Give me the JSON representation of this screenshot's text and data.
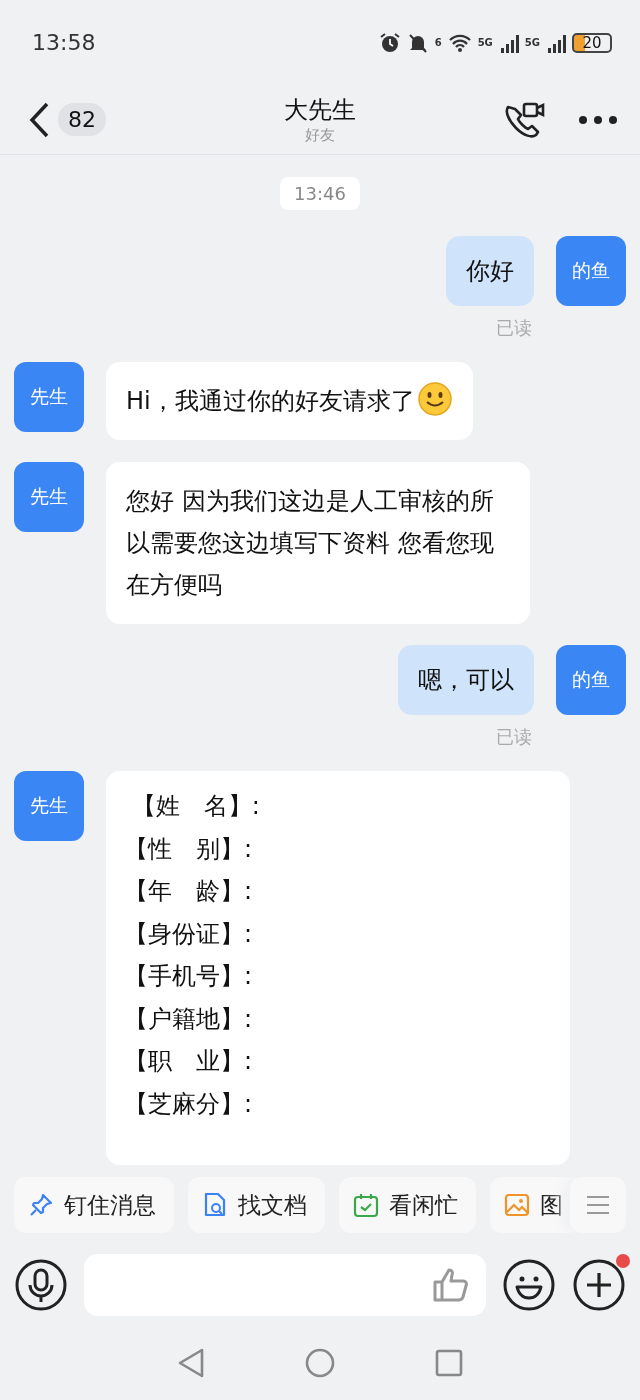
{
  "status_bar": {
    "time": "13:58",
    "network_label": "6",
    "sim1": "5G",
    "sim2": "5G",
    "battery": "20"
  },
  "header": {
    "back_count": "82",
    "title": "大先生",
    "subtitle": "好友"
  },
  "messages": [
    {
      "kind": "time",
      "text": "13:46"
    },
    {
      "kind": "outgoing",
      "avatar": "的鱼",
      "text": "你好",
      "receipt": "已读"
    },
    {
      "kind": "incoming",
      "avatar": "先生",
      "text": "Hi，我通过你的好友请求了",
      "emoji": true
    },
    {
      "kind": "incoming",
      "avatar": "先生",
      "text": "您好  因为我们这边是人工审核的所以需要您这边填写下资料  您看您现在方便吗"
    },
    {
      "kind": "outgoing",
      "avatar": "的鱼",
      "text": "嗯，可以",
      "receipt": "已读"
    },
    {
      "kind": "form",
      "avatar": "先生",
      "lines": [
        " 【姓　名】:",
        "【性　别】:",
        "【年　龄】:",
        "【身份证】:",
        "【手机号】:",
        "【户籍地】:",
        "【职　业】:",
        "【芝麻分】:"
      ]
    }
  ],
  "quick_actions": [
    {
      "kind": "pin",
      "label": "钉住消息"
    },
    {
      "kind": "doc",
      "label": "找文档"
    },
    {
      "kind": "calendar",
      "label": "看闲忙"
    },
    {
      "kind": "image",
      "label": "图"
    }
  ],
  "composer": {
    "plus_badge": true
  }
}
